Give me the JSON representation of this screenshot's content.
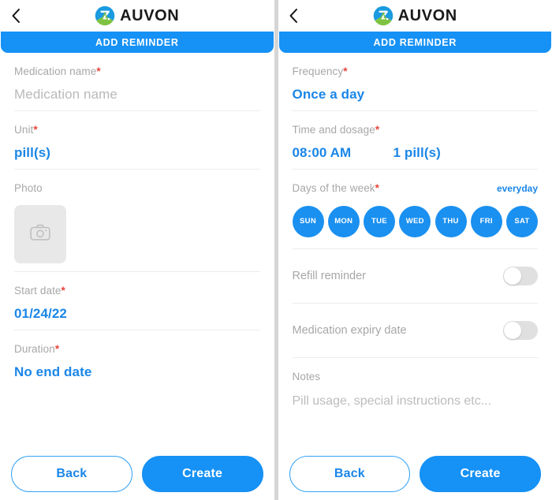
{
  "app": {
    "brand_name": "AUVON",
    "screen_title": "ADD REMINDER",
    "back_icon": "chevron-left-icon",
    "logo_icon": "auvon-logo-icon",
    "accent_color": "#1691f5",
    "value_color": "#1a86e8",
    "label_color": "#a7a7a7",
    "required_color": "#e8453c"
  },
  "screen_left": {
    "fields": [
      {
        "label": "Medication name",
        "required": "*",
        "placeholder": "Medication name",
        "value": ""
      },
      {
        "label": "Unit",
        "required": "*",
        "value": "pill(s)"
      },
      {
        "label": "Photo",
        "required": "",
        "photo_icon": "camera-icon",
        "photo_value": ""
      },
      {
        "label": "Start date",
        "required": "*",
        "value": "01/24/22"
      },
      {
        "label": "Duration",
        "required": "*",
        "value": "No end date"
      }
    ],
    "footer": {
      "back_label": "Back",
      "create_label": "Create"
    }
  },
  "screen_right": {
    "frequency": {
      "label": "Frequency",
      "required": "*",
      "value": "Once a day"
    },
    "time_and_dosage": {
      "label": "Time and dosage",
      "required": "*",
      "time": "08:00 AM",
      "dosage": "1 pill(s)"
    },
    "days_of_week": {
      "label": "Days of the week",
      "required": "*",
      "link_label": "everyday",
      "days": [
        {
          "label": "SUN",
          "selected": true
        },
        {
          "label": "MON",
          "selected": true
        },
        {
          "label": "TUE",
          "selected": true
        },
        {
          "label": "WED",
          "selected": true
        },
        {
          "label": "THU",
          "selected": true
        },
        {
          "label": "FRI",
          "selected": true
        },
        {
          "label": "SAT",
          "selected": true
        }
      ]
    },
    "refill_reminder": {
      "label": "Refill reminder",
      "enabled": false
    },
    "medication_expiry": {
      "label": "Medication expiry date",
      "enabled": false
    },
    "notes": {
      "label": "Notes",
      "placeholder": "Pill usage, special instructions etc...",
      "value": ""
    },
    "footer": {
      "back_label": "Back",
      "create_label": "Create"
    }
  }
}
